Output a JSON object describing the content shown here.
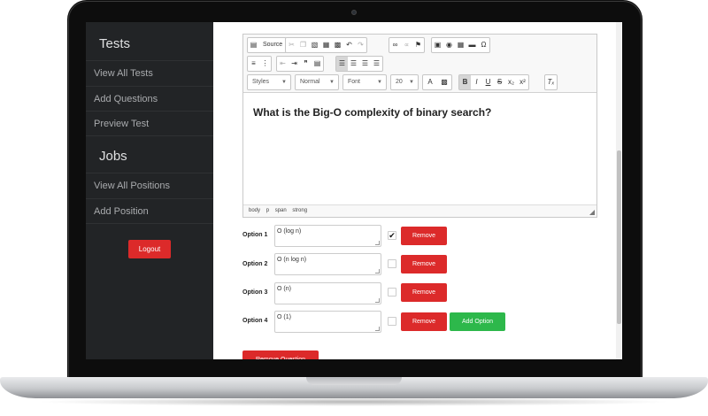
{
  "sidebar": {
    "tests_heading": "Tests",
    "tests_items": [
      "View All Tests",
      "Add Questions",
      "Preview Test"
    ],
    "jobs_heading": "Jobs",
    "jobs_items": [
      "View All Positions",
      "Add Position"
    ],
    "logout_label": "Logout"
  },
  "editor": {
    "source_label": "Source",
    "styles_select": "Styles",
    "format_select": "Normal",
    "font_select": "Font",
    "size_select": "20",
    "content": "What is the Big-O complexity of binary search?",
    "footer_path": [
      "body",
      "p",
      "span",
      "strong"
    ]
  },
  "options": [
    {
      "label": "Option 1",
      "value": "O (log n)",
      "checked": true
    },
    {
      "label": "Option 2",
      "value": "O (n log n)",
      "checked": false
    },
    {
      "label": "Option 3",
      "value": "O (n)",
      "checked": false
    },
    {
      "label": "Option 4",
      "value": "O (1)",
      "checked": false
    }
  ],
  "buttons": {
    "remove_label": "Remove",
    "add_option_label": "Add Option",
    "remove_question_label": "Remove Question"
  },
  "colors": {
    "accent_red": "#dc2a2a",
    "accent_green": "#2db84b",
    "sidebar_bg": "#222426"
  }
}
